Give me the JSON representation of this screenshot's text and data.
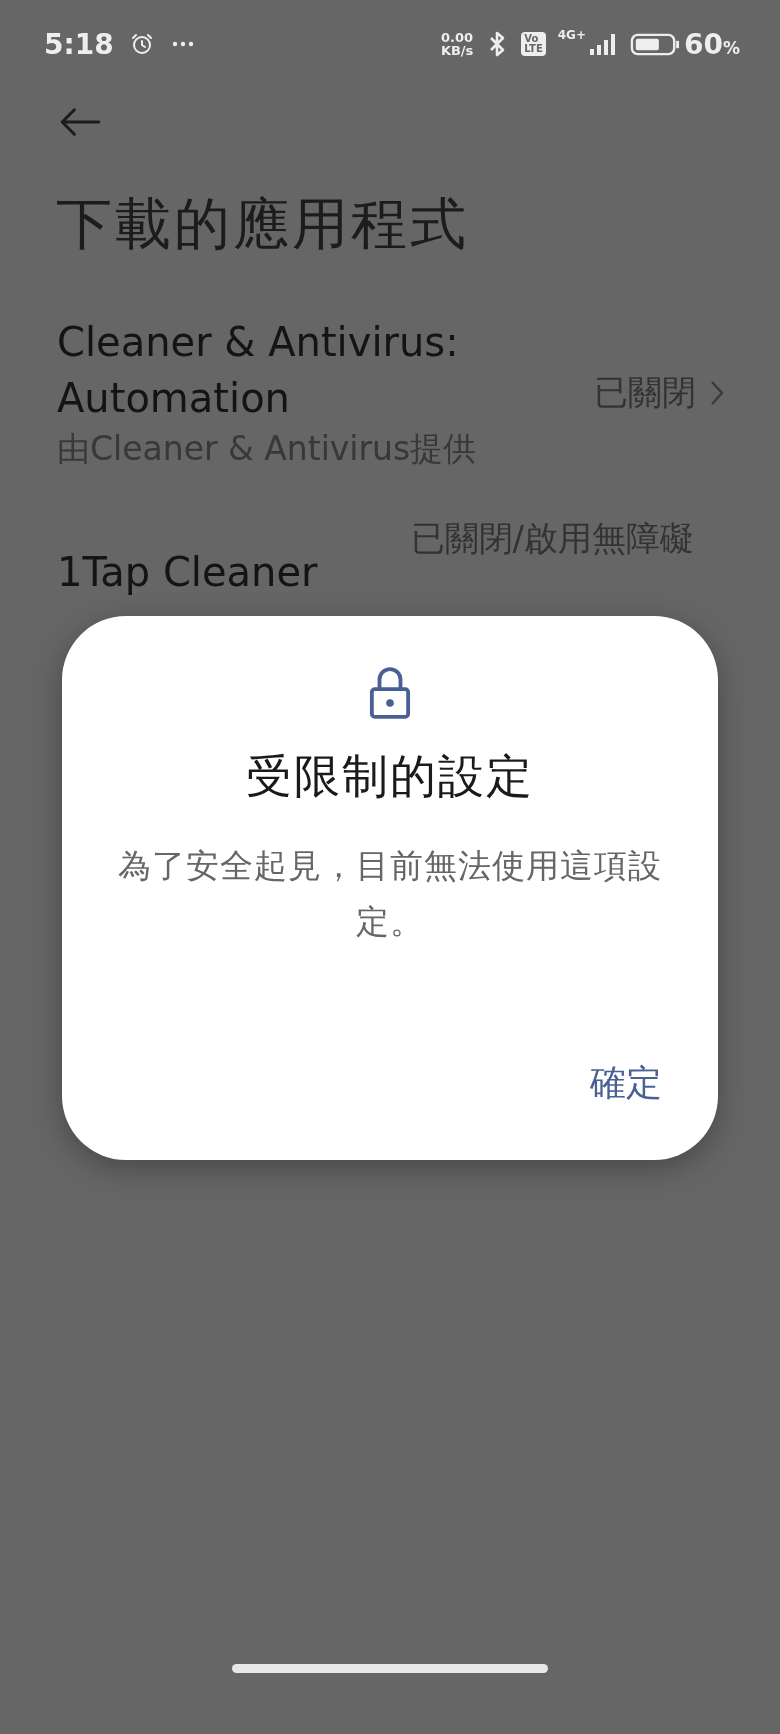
{
  "status_bar": {
    "time": "5:18",
    "net_speed": [
      "0.00",
      "KB/s"
    ],
    "volte": [
      "Vo",
      "LTE"
    ],
    "network": "4G+",
    "battery_percent": "60",
    "battery_unit": "%"
  },
  "app_bar": {
    "title": "下載的應用程式"
  },
  "apps": [
    {
      "name": "Cleaner & Antivirus: Automation",
      "provider": "由Cleaner & Antivirus提供",
      "status": "已關閉"
    },
    {
      "name": "1Tap Cleaner",
      "status": "已關閉/啟用無障礙"
    }
  ],
  "dialog": {
    "title": "受限制的設定",
    "message": "為了安全起見，目前無法使用這項設定。",
    "buttons": [
      "確定"
    ]
  }
}
